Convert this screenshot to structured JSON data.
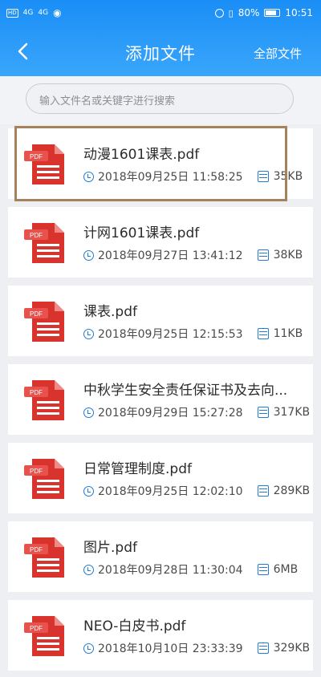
{
  "status": {
    "time": "10:51",
    "battery": "80%",
    "signal_left": "4G",
    "signal_right": "4G",
    "hd": "HD"
  },
  "header": {
    "back_icon": "chevron-left-icon",
    "title": "添加文件",
    "all_files": "全部文件"
  },
  "search": {
    "placeholder": "输入文件名或关键字进行搜索"
  },
  "colors": {
    "header_blue": "#2196f3",
    "icon_blue": "#1e7bd6",
    "pdf_red": "#d9332e",
    "highlight_border": "#a6825c"
  },
  "files": [
    {
      "name": "动漫1601课表.pdf",
      "date": "2018年09月25日 11:58:25",
      "size": "35KB",
      "selected": true
    },
    {
      "name": "计网1601课表.pdf",
      "date": "2018年09月27日 13:41:12",
      "size": "38KB"
    },
    {
      "name": "课表.pdf",
      "date": "2018年09月25日 12:15:53",
      "size": "11KB"
    },
    {
      "name": "中秋学生安全责任保证书及去向...",
      "date": "2018年09月29日 15:27:28",
      "size": "317KB"
    },
    {
      "name": "日常管理制度.pdf",
      "date": "2018年09月25日 12:02:10",
      "size": "289KB"
    },
    {
      "name": "图片.pdf",
      "date": "2018年09月28日 11:30:04",
      "size": "6MB"
    },
    {
      "name": "NEO-白皮书.pdf",
      "date": "2018年10月10日 23:33:39",
      "size": "329KB"
    }
  ],
  "pdf_label": "PDF"
}
